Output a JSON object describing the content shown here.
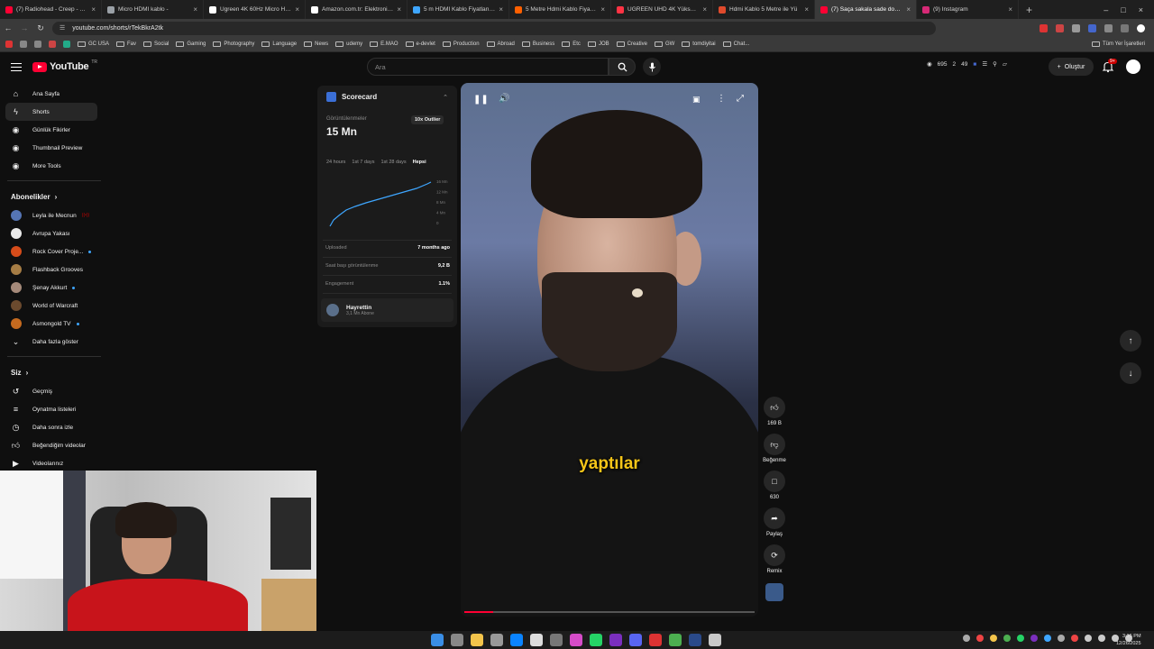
{
  "browser": {
    "tabs": [
      {
        "title": "(7) Radiohead - Creep - YouTube",
        "color": "#ff0033"
      },
      {
        "title": "Micro HDMI kablo - ",
        "color": "#9aa0a6"
      },
      {
        "title": "Ugreen 4K 60Hz Micro HDMI",
        "color": "#ffffff"
      },
      {
        "title": "Amazon.com.tr: Elektronik, bil",
        "color": "#ffffff"
      },
      {
        "title": "5 m HDMI Kablo Fiyatları | En",
        "color": "#3ea6ff"
      },
      {
        "title": "5 Metre Hdmi Kablo Fiyatları",
        "color": "#ff6000"
      },
      {
        "title": "UGREEN UHD 4K Yüksek Hız",
        "color": "#ff3344"
      },
      {
        "title": "Hdmi Kablo 5 Metre ile Yü",
        "color": "#e04a2c"
      },
      {
        "title": "(7) Saça sakala sade dokun",
        "color": "#ff0033"
      },
      {
        "title": "(9) Instagram",
        "color": "#d62976"
      }
    ],
    "active_tab": 8,
    "new_tab": "+",
    "url": "youtube.com/shorts/rTekBkrA2tk",
    "bookmarks": [
      "GC USA",
      "Fav",
      "Social",
      "Gaming",
      "Photography",
      "Language",
      "News",
      "udemy",
      "E.MAO",
      "e-devlet",
      "Production",
      "Abroad",
      "Business",
      "Etc",
      "JOB",
      "Creative",
      "GW",
      "tomdiyitai",
      "Chat..."
    ],
    "bookmarks_right": "Tüm Yer İşaretleri"
  },
  "youtube": {
    "logo": "YouTube",
    "logo_region": "TR",
    "search_placeholder": "Ara",
    "header_stats": {
      "views": "695",
      "comments": "2",
      "subs": "49"
    },
    "create_label": "Oluştur",
    "notif_badge": "9+"
  },
  "sidebar": {
    "main": [
      {
        "label": "Ana Sayfa",
        "icon": "home-icon"
      },
      {
        "label": "Shorts",
        "icon": "shorts-icon"
      },
      {
        "label": "Günlük Fikirler",
        "icon": "idea-icon"
      },
      {
        "label": "Thumbnail Preview",
        "icon": "preview-icon"
      },
      {
        "label": "More Tools",
        "icon": "tools-icon"
      }
    ],
    "subs_title": "Abonelikler",
    "subscriptions": [
      {
        "label": "Leyla ile Mecnun",
        "color": "#5575b5",
        "live": true
      },
      {
        "label": "Avrupa Yakası",
        "color": "#e9e9e9",
        "live": false
      },
      {
        "label": "Rock Cover Proje...",
        "color": "#d64c1a",
        "live": false,
        "dot": true
      },
      {
        "label": "Flashback Grooves",
        "color": "#a67d45",
        "live": false
      },
      {
        "label": "Şenay Akkurt",
        "color": "#a58a7a",
        "live": false,
        "dot": true
      },
      {
        "label": "World of Warcraft",
        "color": "#6b4a2e",
        "live": false
      },
      {
        "label": "Asmongold TV",
        "color": "#c56a1f",
        "live": false,
        "dot": true
      }
    ],
    "show_more": "Daha fazla göster",
    "you_title": "Siz",
    "you": [
      {
        "label": "Geçmiş",
        "icon": "history-icon"
      },
      {
        "label": "Oynatma listeleri",
        "icon": "playlist-icon"
      },
      {
        "label": "Daha sonra izle",
        "icon": "clock-icon"
      },
      {
        "label": "Beğendiğim videolar",
        "icon": "like-icon"
      },
      {
        "label": "Videolarınız",
        "icon": "video-icon"
      }
    ]
  },
  "scorecard": {
    "title": "Scorecard",
    "views_label": "Görüntülenmeler",
    "views_value": "15 Mn",
    "outlier": "10x Outlier",
    "tabs": [
      "24 hours",
      "1st 7 days",
      "1st 28 days",
      "Hepsi"
    ],
    "active_tab": 3,
    "y_ticks": [
      "16 Mn",
      "12 Mn",
      "8 Mn",
      "4 Mn",
      "0"
    ],
    "rows": [
      {
        "label": "Uploaded",
        "value": "7 months ago"
      },
      {
        "label": "Saat başı görüntülenme",
        "value": "9,2 B"
      },
      {
        "label": "Engagement",
        "value": "1.1%"
      }
    ],
    "channel_name": "Hayrettin",
    "channel_subs": "3,1 Mn Abone"
  },
  "video": {
    "caption": "yaptılar",
    "progress": 0.1
  },
  "actions": {
    "likes": "169 B",
    "dislike": "Beğenme",
    "comments": "630",
    "share": "Paylaş",
    "remix": "Remix"
  },
  "taskbar": {
    "time": "3:15 PM",
    "date": "12/26/2025"
  }
}
